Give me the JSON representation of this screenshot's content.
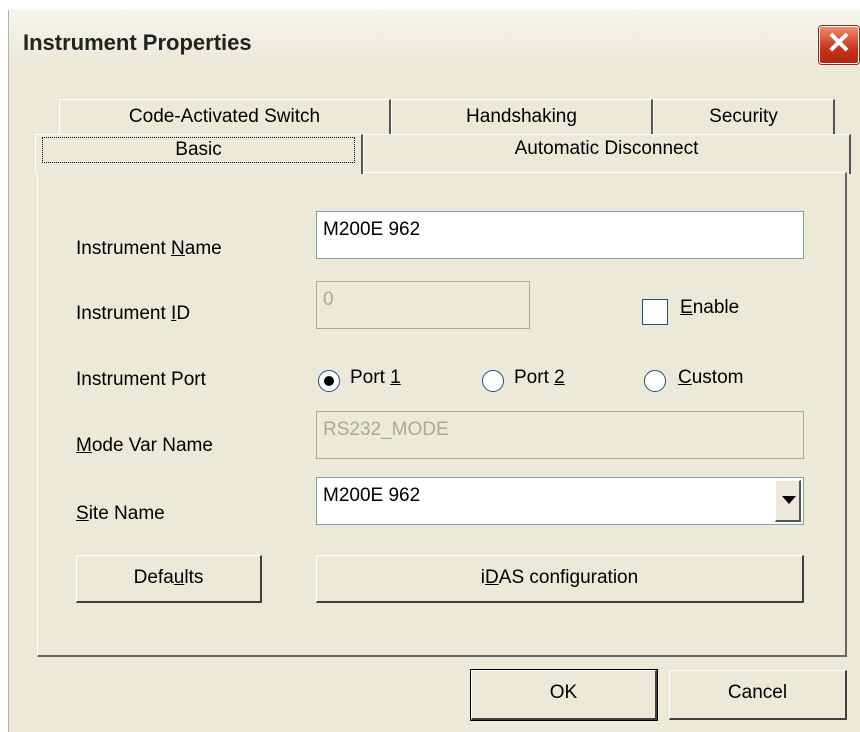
{
  "window": {
    "title": "Instrument Properties",
    "close": "✕"
  },
  "tabs": {
    "row1": [
      "Code-Activated Switch",
      "Handshaking",
      "Security"
    ],
    "row2": [
      "Basic",
      "Automatic Disconnect"
    ],
    "active": "Basic"
  },
  "form": {
    "instrument_name": {
      "label_pre": "Instrument ",
      "label_key": "N",
      "label_post": "ame",
      "value": "M200E 962"
    },
    "instrument_id": {
      "label_pre": "Instrument ",
      "label_key": "I",
      "label_post": "D",
      "value": "0",
      "disabled": true
    },
    "enable": {
      "label_key": "E",
      "label_post": "nable",
      "checked": false
    },
    "instrument_port": {
      "label": "Instrument Port",
      "options": [
        {
          "pre": "Port ",
          "key": "1",
          "post": "",
          "checked": true
        },
        {
          "pre": "Port ",
          "key": "2",
          "post": "",
          "checked": false
        },
        {
          "pre": "",
          "key": "C",
          "post": "ustom",
          "checked": false
        }
      ]
    },
    "mode_var_name": {
      "label_key": "M",
      "label_post": "ode Var Name",
      "value": "RS232_MODE",
      "disabled": true
    },
    "site_name": {
      "label_key": "S",
      "label_post": "ite Name",
      "value": "M200E 962"
    }
  },
  "buttons": {
    "defaults": {
      "pre": "Defa",
      "key": "u",
      "post": "lts"
    },
    "idas": {
      "pre": "i",
      "key": "D",
      "post": "AS configuration"
    },
    "ok": "OK",
    "cancel": "Cancel"
  }
}
